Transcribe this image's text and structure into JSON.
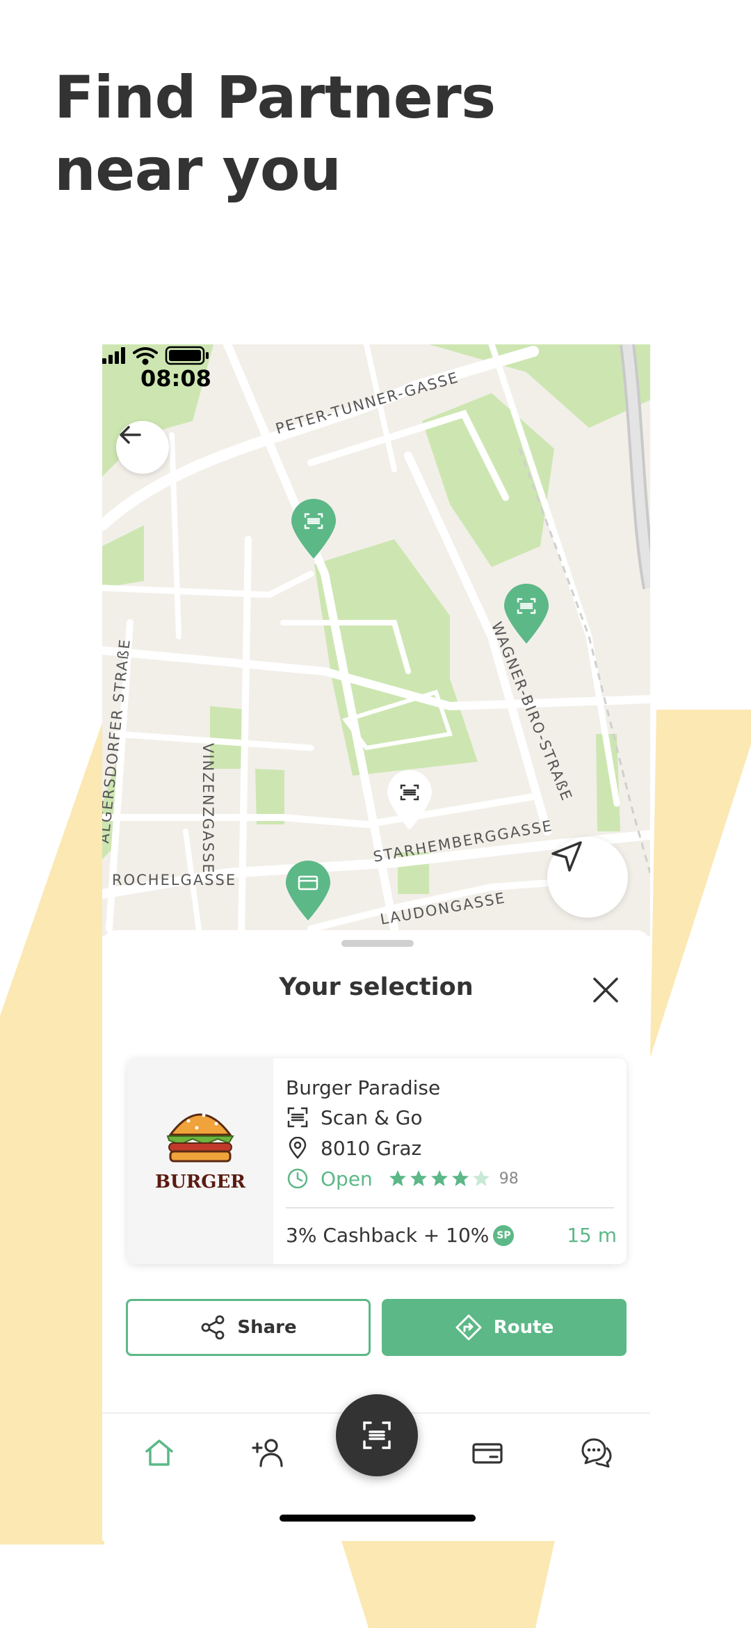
{
  "headline": {
    "line1": "Find Partners",
    "line2": "near you"
  },
  "colors": {
    "accent": "#5cb887",
    "dark": "#333333",
    "background_shape": "#fbe8b3"
  },
  "status_bar": {
    "time": "08:08"
  },
  "map": {
    "streets": [
      "PETER-TUNNER-GASSE",
      "WAGNER-BIRO-STRAßE",
      "ALGERSDORFER STRAßE",
      "VINZENZGASSE",
      "STARHEMBERGGASSE",
      "ROCHELGASSE",
      "LAUDONGASSE"
    ],
    "pins": [
      {
        "type": "scan",
        "selected": false
      },
      {
        "type": "scan",
        "selected": false
      },
      {
        "type": "scan",
        "selected": true
      },
      {
        "type": "wallet",
        "selected": false
      }
    ]
  },
  "sheet": {
    "title": "Your selection",
    "partner": {
      "logo_text": "BURGER",
      "name": "Burger Paradise",
      "service": "Scan & Go",
      "city": "8010 Graz",
      "status": "Open",
      "rating": 4,
      "reviews": "98",
      "cashback": "3% Cashback + 10%",
      "points_badge": "SP",
      "distance": "15 m"
    },
    "buttons": {
      "share": "Share",
      "route": "Route"
    }
  },
  "nav": {
    "items": [
      "home-icon",
      "add-contact-icon",
      "scan-icon",
      "wallet-icon",
      "chat-icon"
    ],
    "active": "home-icon"
  }
}
